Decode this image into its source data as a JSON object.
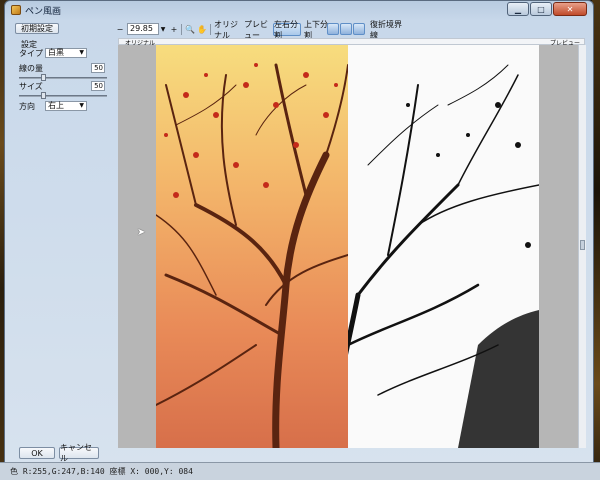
{
  "window": {
    "title": "ペン風画"
  },
  "left": {
    "reset_label": "初期設定",
    "section_label": "設定",
    "type_label": "タイプ",
    "type_value": "白黒",
    "lineamount_label": "線の量",
    "lineamount_value": "50",
    "size_label": "サイズ",
    "size_value": "50",
    "direction_label": "方向",
    "direction_value": "右上",
    "ok_label": "OK",
    "cancel_label": "キャンセル"
  },
  "toolbar": {
    "minus": "−",
    "zoom": "29.85",
    "plus": "+",
    "original": "オリジナル",
    "preview": "プレビュー",
    "split_lr": "左右分割",
    "split_tb": "上下分割",
    "boundary": "復折境界線"
  },
  "view": {
    "original_label": "オリジナル",
    "preview_label": "プレビュー"
  },
  "status": {
    "text": "色 R:255,G:247,B:140  座標 X: 000,Y: 084"
  }
}
